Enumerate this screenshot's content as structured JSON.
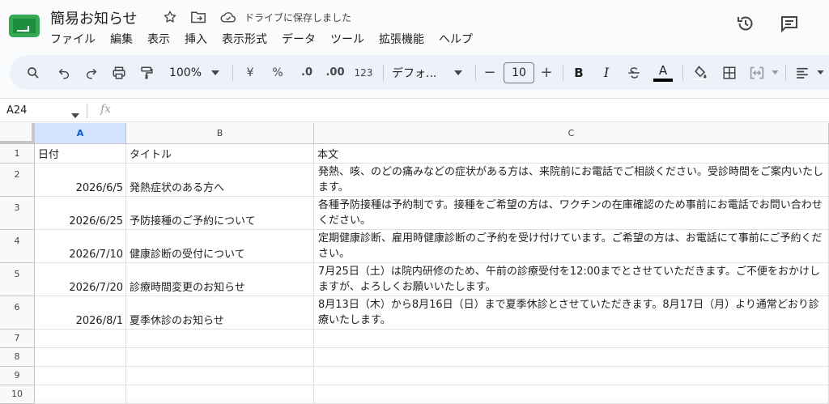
{
  "doc": {
    "title": "簡易お知らせ",
    "saved_status": "ドライブに保存しました"
  },
  "menu": [
    "ファイル",
    "編集",
    "表示",
    "挿入",
    "表示形式",
    "データ",
    "ツール",
    "拡張機能",
    "ヘルプ"
  ],
  "toolbar": {
    "zoom": "100%",
    "currency": "¥",
    "percent": "%",
    "dec_decrease": ".0",
    "dec_increase": ".00",
    "format_123": "123",
    "font": "デフォ...",
    "font_size": "10",
    "minus": "−",
    "plus": "+",
    "bold": "B",
    "italic": "I",
    "strike": "S",
    "text_color_letter": "A",
    "text_color": "#000000"
  },
  "formula": {
    "cell_ref": "A24",
    "fx": "fx"
  },
  "columns": [
    "A",
    "B",
    "C"
  ],
  "rows": [
    {
      "num": "1",
      "a": "日付",
      "b": "タイトル",
      "c": "本文"
    },
    {
      "num": "2",
      "a": "2026/6/5",
      "b": "発熱症状のある方へ",
      "c": "発熱、咳、のどの痛みなどの症状がある方は、来院前にお電話でご相談ください。受診時間をご案内いたします。"
    },
    {
      "num": "3",
      "a": "2026/6/25",
      "b": "予防接種のご予約について",
      "c": "各種予防接種は予約制です。接種をご希望の方は、ワクチンの在庫確認のため事前にお電話でお問い合わせください。"
    },
    {
      "num": "4",
      "a": "2026/7/10",
      "b": "健康診断の受付について",
      "c": "定期健康診断、雇用時健康診断のご予約を受け付けています。ご希望の方は、お電話にて事前にご予約ください。"
    },
    {
      "num": "5",
      "a": "2026/7/20",
      "b": "診療時間変更のお知らせ",
      "c": "7月25日（土）は院内研修のため、午前の診療受付を12:00までとさせていただきます。ご不便をおかけしますが、よろしくお願いいたします。"
    },
    {
      "num": "6",
      "a": "2026/8/1",
      "b": "夏季休診のお知らせ",
      "c": "8月13日（木）から8月16日（日）まで夏季休診とさせていただきます。8月17日（月）より通常どおり診療いたします。"
    },
    {
      "num": "7",
      "a": "",
      "b": "",
      "c": ""
    },
    {
      "num": "8",
      "a": "",
      "b": "",
      "c": ""
    },
    {
      "num": "9",
      "a": "",
      "b": "",
      "c": ""
    },
    {
      "num": "10",
      "a": "",
      "b": "",
      "c": ""
    }
  ],
  "colors": {
    "accent": "#0b57d0",
    "selected_header": "#d3e3fd",
    "logo": "#34a853"
  }
}
